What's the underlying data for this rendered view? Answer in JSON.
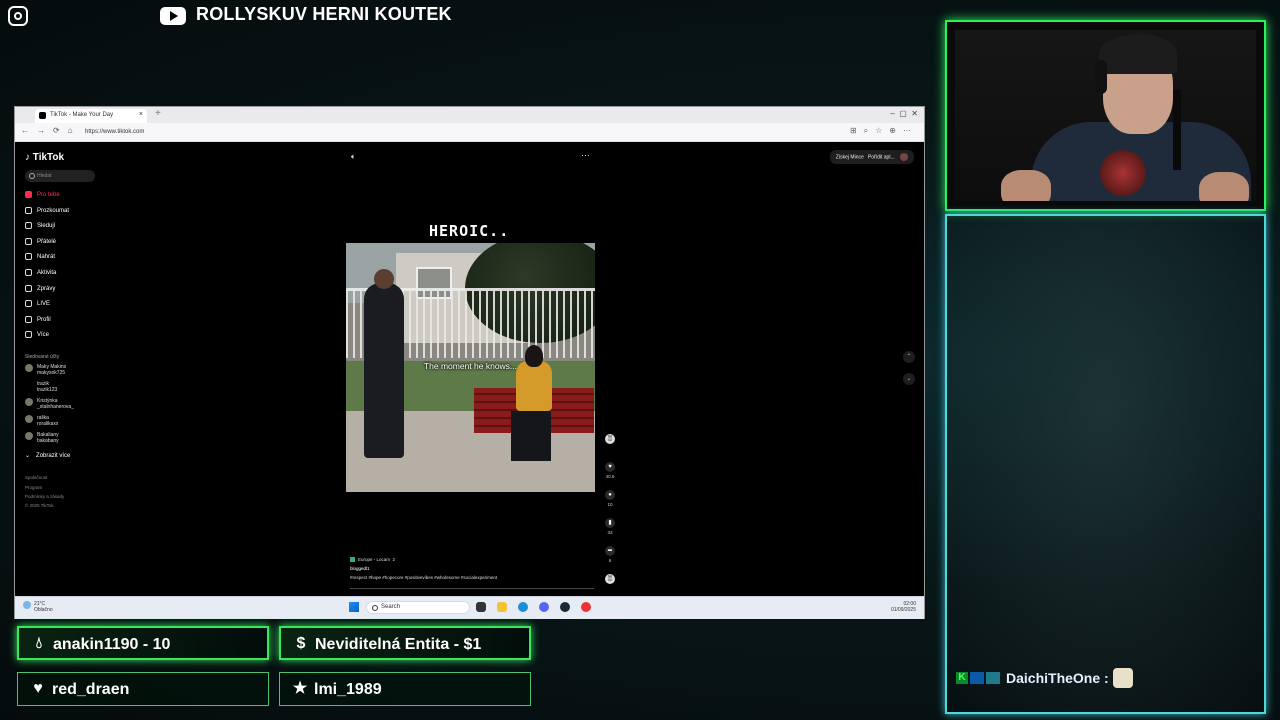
{
  "overlay": {
    "channel_name": "ROLLYSKUV HERNI KOUTEK",
    "instagram_icon": "instagram-icon",
    "youtube_icon": "youtube-icon"
  },
  "browser": {
    "tab_title": "TikTok - Make Your Day",
    "url": "https://www.tiktok.com"
  },
  "tiktok": {
    "logo": "TikTok",
    "search_placeholder": "Hledat",
    "nav": [
      {
        "label": "Pro tebe",
        "active": true
      },
      {
        "label": "Prozkoumat"
      },
      {
        "label": "Sledují"
      },
      {
        "label": "Přátelé"
      },
      {
        "label": "Nahrát"
      },
      {
        "label": "Aktivita"
      },
      {
        "label": "Zprávy"
      },
      {
        "label": "LIVE"
      },
      {
        "label": "Profil"
      },
      {
        "label": "Více"
      }
    ],
    "following_label": "Sledované účty",
    "following": [
      {
        "name": "Maky Makins",
        "handle": "makysok725"
      },
      {
        "name": "trazik",
        "handle": "trazik123"
      },
      {
        "name": "Kristýnka",
        "handle": "_stalnhanerova_"
      },
      {
        "name": "ralika",
        "handle": "roralikaxx"
      },
      {
        "name": "Bakaliany",
        "handle": "bakabany"
      }
    ],
    "show_more": "Zobrazit více",
    "footer": [
      "Společnost",
      "Program",
      "Podmínky a zásady",
      "© 2025 TikTok"
    ],
    "top_right": {
      "coins": "Získej Mince",
      "app": "Pořídit apl..."
    },
    "video": {
      "title_text": "HEROIC..",
      "caption": "The moment he knows...",
      "location": "Europe - Locam",
      "location_count": "2",
      "author": "bloggedl1",
      "hashtags": "#respect #hope #hopecore #positivevibes #wholesome #socialexperiment"
    },
    "actions": [
      {
        "name": "like",
        "count": "40.6"
      },
      {
        "name": "comment",
        "count": "10"
      },
      {
        "name": "save",
        "count": "33"
      },
      {
        "name": "share",
        "count": "6"
      }
    ]
  },
  "taskbar": {
    "weather_temp": "21°C",
    "weather_desc": "Oblačno",
    "search_label": "Search",
    "time": "02:00",
    "date": "01/09/2025"
  },
  "alerts": [
    {
      "text": "anakin1190 - 10",
      "icon": "drop-icon",
      "highlight": true
    },
    {
      "text": "Neviditelná Entita - $1",
      "icon": "dollar-icon",
      "highlight": true
    },
    {
      "text": "red_draen",
      "icon": "heart-icon",
      "highlight": false
    },
    {
      "text": "lmi_1989",
      "icon": "star-icon",
      "highlight": false
    }
  ],
  "chat": {
    "username": "DaichiTheOne",
    "separator": ":"
  },
  "colors": {
    "accent_green": "#2df05c",
    "accent_cyan": "#4fd8d8",
    "tiktok_red": "#fe2c55"
  }
}
